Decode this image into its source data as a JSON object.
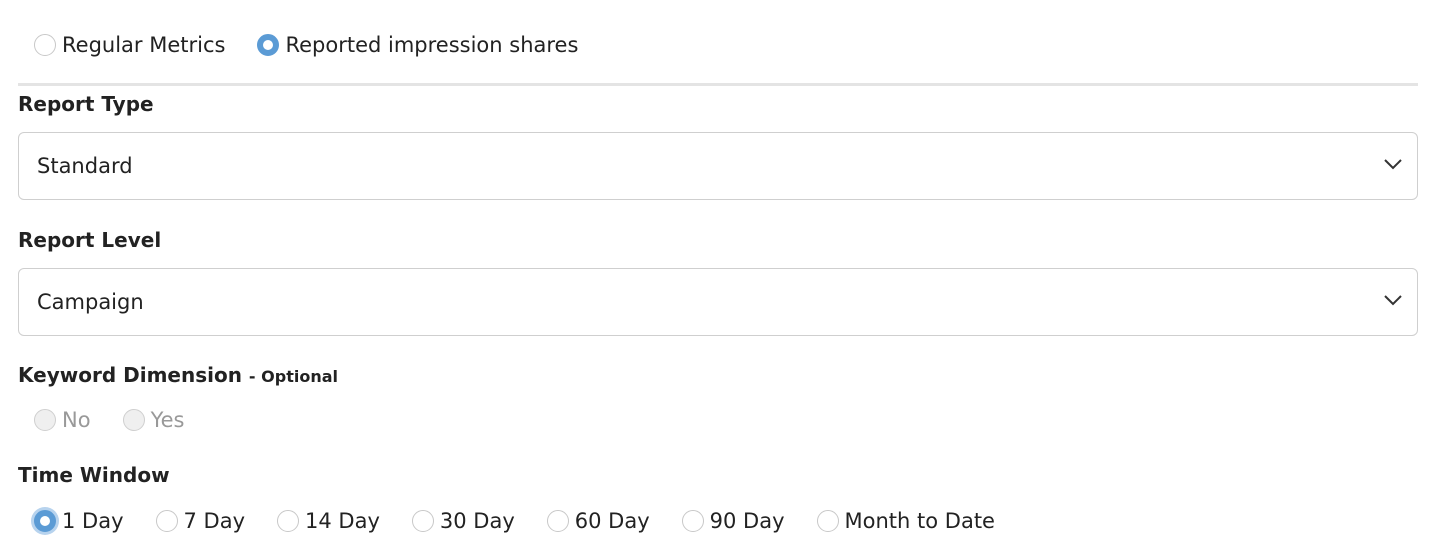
{
  "metric_mode": {
    "options": [
      {
        "label": "Regular Metrics",
        "checked": false
      },
      {
        "label": "Reported impression shares",
        "checked": true
      }
    ]
  },
  "report_type": {
    "label": "Report Type",
    "value": "Standard",
    "icon": "chevron-down-icon"
  },
  "report_level": {
    "label": "Report Level",
    "value": "Campaign",
    "icon": "chevron-down-icon"
  },
  "keyword_dimension": {
    "label": "Keyword Dimension",
    "optional": "- Optional",
    "options": [
      {
        "label": "No",
        "disabled": true
      },
      {
        "label": "Yes",
        "disabled": true
      }
    ]
  },
  "time_window": {
    "label": "Time Window",
    "options": [
      {
        "label": "1 Day",
        "checked": true
      },
      {
        "label": "7 Day"
      },
      {
        "label": "14 Day"
      },
      {
        "label": "30 Day"
      },
      {
        "label": "60 Day"
      },
      {
        "label": "90 Day"
      },
      {
        "label": "Month to Date"
      }
    ]
  },
  "colors": {
    "accent": "#5b9bd5",
    "border": "#cfcfcf"
  }
}
